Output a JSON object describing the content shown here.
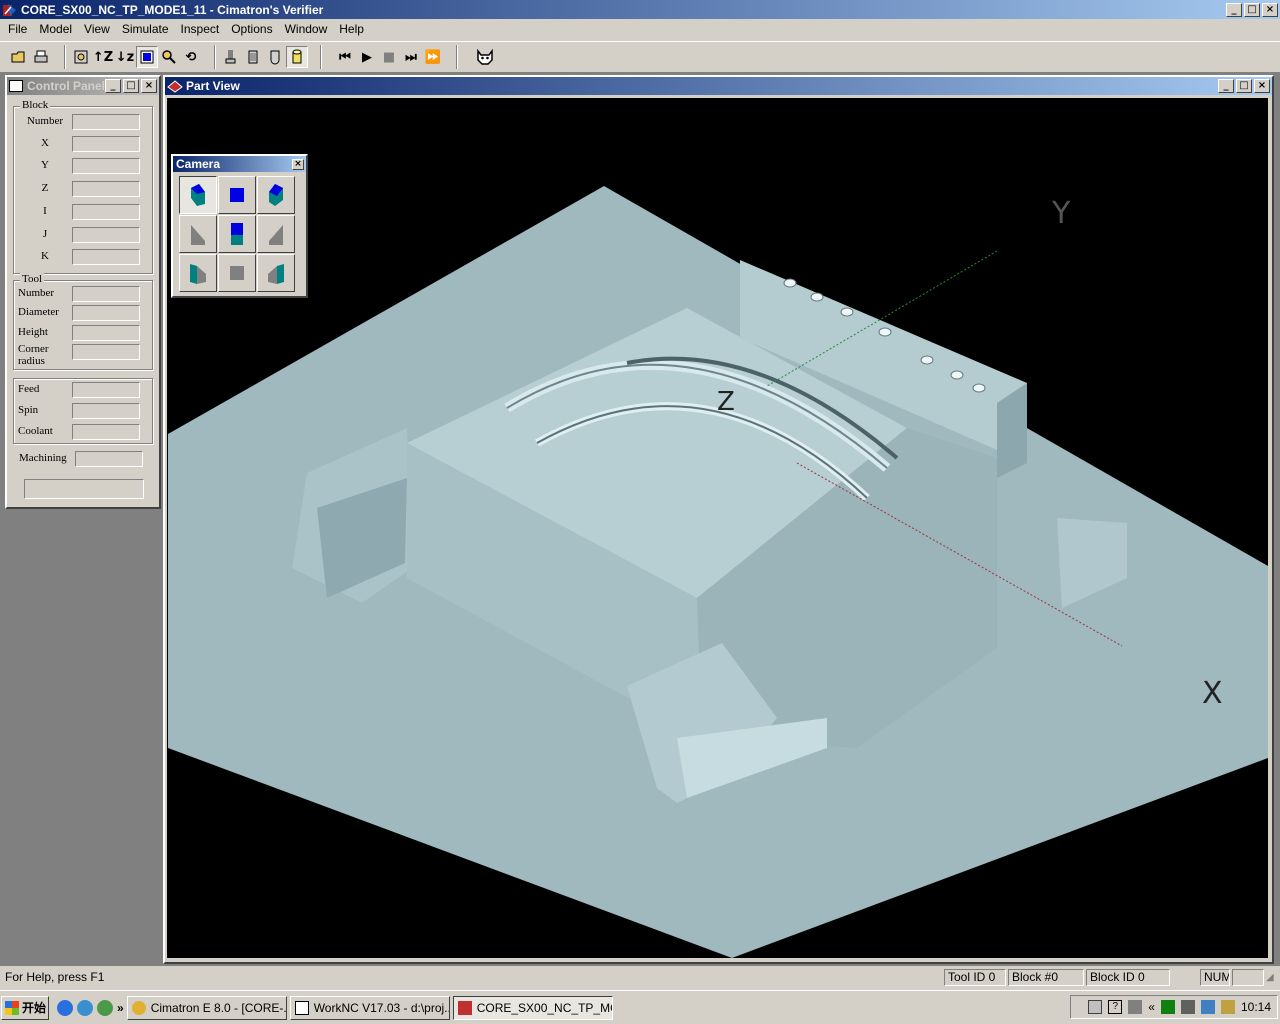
{
  "window": {
    "title": "CORE_SX00_NC_TP_MODE1_11 - Cimatron's Verifier"
  },
  "menu": {
    "items": [
      "File",
      "Model",
      "View",
      "Simulate",
      "Inspect",
      "Options",
      "Window",
      "Help"
    ]
  },
  "control_panel": {
    "title": "Control Panel",
    "block_group": {
      "legend": "Block",
      "fields": [
        "Number",
        "X",
        "Y",
        "Z",
        "I",
        "J",
        "K"
      ]
    },
    "tool_group": {
      "legend": "Tool",
      "fields": [
        "Number",
        "Diameter",
        "Height",
        "Corner radius"
      ]
    },
    "feed_group": {
      "fields": [
        "Feed",
        "Spin",
        "Coolant"
      ]
    },
    "machining_label": "Machining"
  },
  "part_view": {
    "title": "Part View",
    "axis_labels": {
      "x": "X",
      "y": "Y",
      "z": "Z"
    }
  },
  "camera": {
    "title": "Camera"
  },
  "statusbar": {
    "help": "For Help, press F1",
    "tool_id": "Tool ID 0",
    "block": "Block #0",
    "block_id": "Block ID 0",
    "num": "NUM"
  },
  "taskbar": {
    "start_label": "开始",
    "tasks": [
      {
        "label": "Cimatron E 8.0 - [CORE-..."
      },
      {
        "label": "WorkNC V17.03 - d:\\proj..."
      },
      {
        "label": "CORE_SX00_NC_TP_MO..."
      }
    ],
    "time": "10:14"
  },
  "colors": {
    "titlebar_active": "#0a246a",
    "part_surface": "#9fb9bf",
    "viewport_bg": "#000000"
  }
}
